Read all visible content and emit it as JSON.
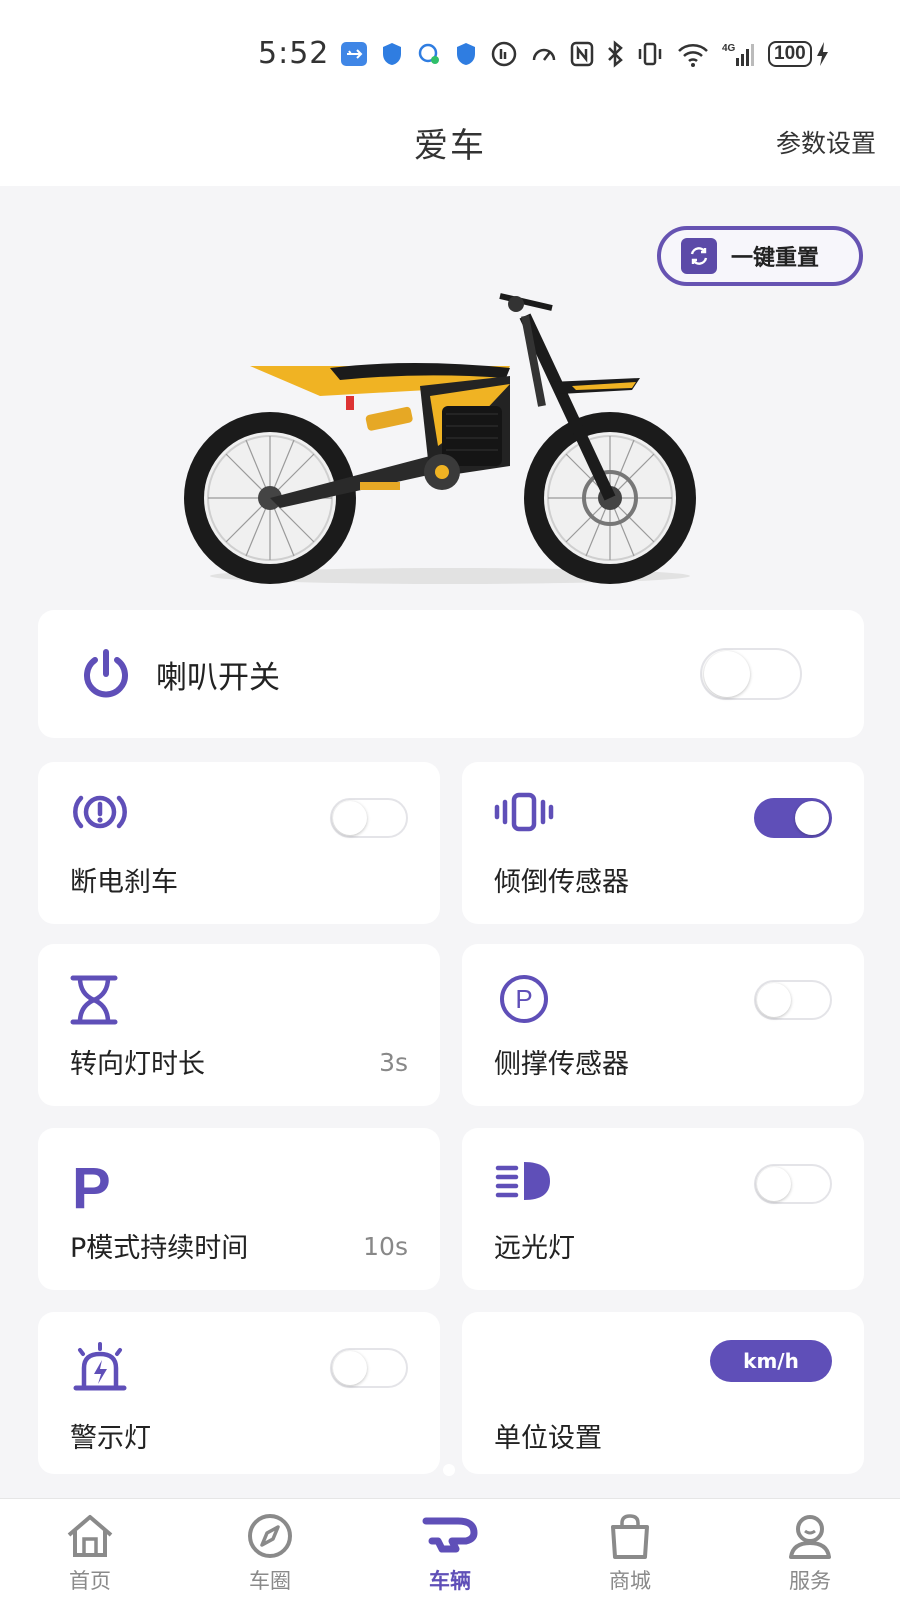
{
  "status_bar": {
    "time": "5:52",
    "battery": "100",
    "network": "4G"
  },
  "header": {
    "title": "爱车",
    "action": "参数设置"
  },
  "hero": {
    "reset_label": "一键重置"
  },
  "horn": {
    "label": "喇叭开关",
    "enabled": false
  },
  "cells": {
    "power_brake": {
      "label": "断电刹车",
      "icon": "brake-warning-icon",
      "enabled": false
    },
    "tilt_sensor": {
      "label": "倾倒传感器",
      "icon": "vibration-icon",
      "enabled": true
    },
    "turn_signal": {
      "label": "转向灯时长",
      "value": "3s",
      "icon": "hourglass-icon"
    },
    "kickstand": {
      "label": "侧撑传感器",
      "icon": "parking-circle-icon",
      "enabled": false
    },
    "p_mode": {
      "label": "P模式持续时间",
      "value": "10s",
      "icon": "p-letter-icon"
    },
    "high_beam": {
      "label": "远光灯",
      "icon": "high-beam-icon",
      "enabled": false
    },
    "warning_light": {
      "label": "警示灯",
      "icon": "alarm-light-icon",
      "enabled": false
    },
    "unit": {
      "label": "单位设置",
      "value": "km/h"
    }
  },
  "tabs": [
    {
      "label": "首页",
      "icon": "home-icon",
      "active": false
    },
    {
      "label": "车圈",
      "icon": "compass-icon",
      "active": false
    },
    {
      "label": "车辆",
      "icon": "vehicle-icon",
      "active": true
    },
    {
      "label": "商城",
      "icon": "shopping-bag-icon",
      "active": false
    },
    {
      "label": "服务",
      "icon": "service-person-icon",
      "active": false
    }
  ],
  "colors": {
    "accent": "#5f4fb8",
    "background": "#f5f5f7",
    "card": "#ffffff"
  }
}
